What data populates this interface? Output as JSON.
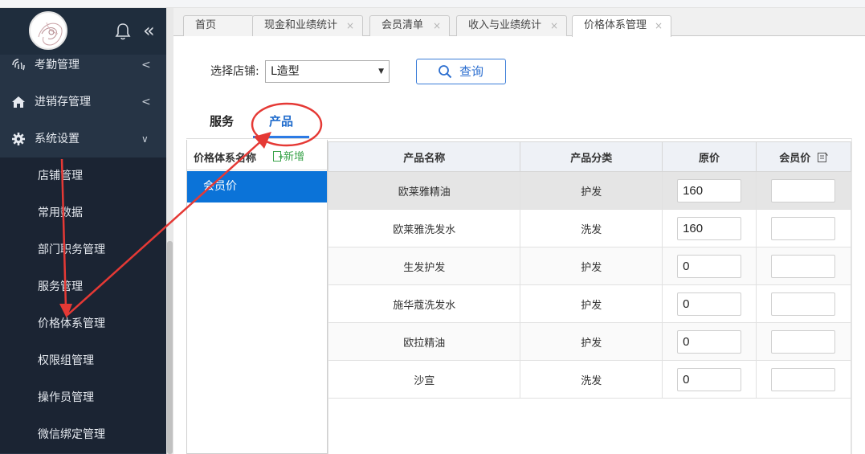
{
  "sidebar": {
    "menu": [
      {
        "label": "考勤管理",
        "icon": "fingerprint-icon"
      },
      {
        "label": "进销存管理",
        "icon": "home-icon"
      },
      {
        "label": "系统设置",
        "icon": "gear-icon"
      }
    ],
    "subitems": [
      "店铺管理",
      "常用数据",
      "部门职务管理",
      "服务管理",
      "价格体系管理",
      "权限组管理",
      "操作员管理",
      "微信绑定管理"
    ]
  },
  "tabs": [
    {
      "label": "首页"
    },
    {
      "label": "现金和业绩统计"
    },
    {
      "label": "会员清单"
    },
    {
      "label": "收入与业绩统计"
    },
    {
      "label": "价格体系管理"
    }
  ],
  "tab_close": "×",
  "filter": {
    "label": "选择店铺:",
    "store": "L造型",
    "query_label": "查询"
  },
  "type_tabs": {
    "service": "服务",
    "product": "产品"
  },
  "left_panel": {
    "header": "价格体系名称",
    "add_label": "新增",
    "items": [
      "会员价"
    ]
  },
  "table": {
    "headers": {
      "name": "产品名称",
      "category": "产品分类",
      "price": "原价",
      "member_price": "会员价"
    },
    "rows": [
      {
        "name": "欧莱雅精油",
        "category": "护发",
        "price": "160",
        "member_price": ""
      },
      {
        "name": "欧莱雅洗发水",
        "category": "洗发",
        "price": "160",
        "member_price": ""
      },
      {
        "name": "生发护发",
        "category": "护发",
        "price": "0",
        "member_price": ""
      },
      {
        "name": "施华蔻洗发水",
        "category": "护发",
        "price": "0",
        "member_price": ""
      },
      {
        "name": "欧拉精油",
        "category": "护发",
        "price": "0",
        "member_price": ""
      },
      {
        "name": "沙宣",
        "category": "洗发",
        "price": "0",
        "member_price": ""
      }
    ]
  },
  "colors": {
    "accent": "#0b73d8",
    "annotation": "#e53935",
    "sidebar": "#263445"
  }
}
